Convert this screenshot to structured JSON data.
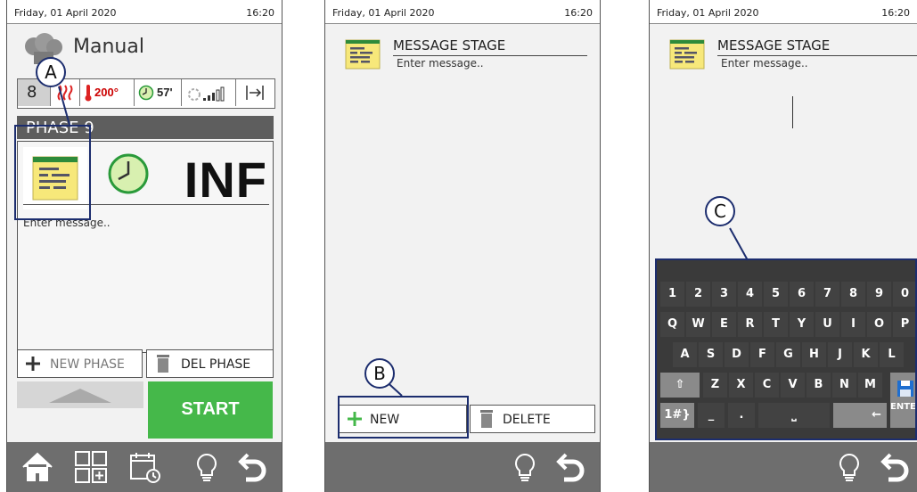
{
  "screen1": {
    "status": {
      "date": "Friday, 01 April 2020",
      "time": "16:20"
    },
    "title": "Manual",
    "phase_number": "8",
    "temperature": "200°",
    "time_value": "57'",
    "phase_header": "PHASE 9",
    "duration_value": "INF",
    "message_placeholder": "Enter message..",
    "new_phase_label": "NEW PHASE",
    "del_phase_label": "DEL PHASE",
    "start_label": "START",
    "callout_label": "A"
  },
  "screen2": {
    "status": {
      "date": "Friday, 01 April 2020",
      "time": "16:20"
    },
    "title": "MESSAGE STAGE",
    "placeholder": "Enter message..",
    "new_label": "NEW",
    "delete_label": "DELETE",
    "callout_label": "B"
  },
  "screen3": {
    "status": {
      "date": "Friday, 01 April 2020",
      "time": "16:20"
    },
    "title": "MESSAGE STAGE",
    "placeholder": "Enter message..",
    "callout_label": "C",
    "keyboard": {
      "row1": [
        "1",
        "2",
        "3",
        "4",
        "5",
        "6",
        "7",
        "8",
        "9",
        "0"
      ],
      "row2": [
        "Q",
        "W",
        "E",
        "R",
        "T",
        "Y",
        "U",
        "I",
        "O",
        "P"
      ],
      "row3": [
        "A",
        "S",
        "D",
        "F",
        "G",
        "H",
        "J",
        "K",
        "L"
      ],
      "row4": [
        "Z",
        "X",
        "C",
        "V",
        "B",
        "N",
        "M"
      ],
      "symbols_key": "1#}",
      "enter_label": "ENTER",
      "shift_glyph": "⇧",
      "backspace_glyph": "←",
      "space_glyph": "⎵",
      "underscore_key": "_",
      "dot_key": "."
    }
  },
  "colors": {
    "accent_green": "#45b84a",
    "callout_blue": "#1c2d6e",
    "nav_gray": "#6e6e6e"
  }
}
